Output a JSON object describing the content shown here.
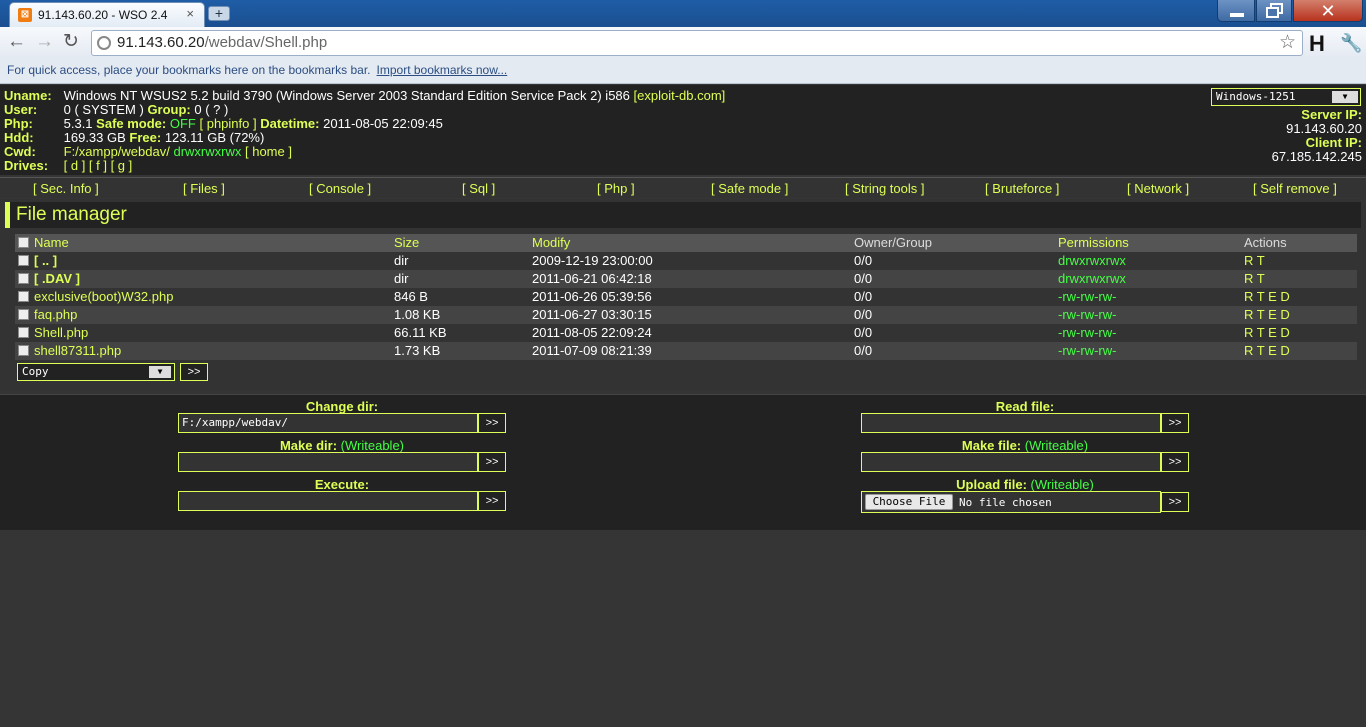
{
  "browser": {
    "tab_title": "91.143.60.20 - WSO 2.4",
    "tab_close": "×",
    "new_tab": "+",
    "url_host": "91.143.60.20",
    "url_path": "/webdav/Shell.php",
    "bookmarks_text": "For quick access, place your bookmarks here on the bookmarks bar.",
    "bookmarks_link": "Import bookmarks now...",
    "h_button": "H"
  },
  "header": {
    "uname_label": "Uname:",
    "uname_value": "Windows NT WSUS2 5.2 build 3790 (Windows Server 2003 Standard Edition Service Pack 2) i586",
    "uname_link": "[exploit-db.com]",
    "user_label": "User:",
    "user_value": "0 ( SYSTEM )",
    "group_label": "Group:",
    "group_value": "0 ( ? )",
    "php_label": "Php:",
    "php_value": "5.3.1",
    "safemode_label": "Safe mode:",
    "safemode_value": "OFF",
    "phpinfo_link": "[ phpinfo ]",
    "datetime_label": "Datetime:",
    "datetime_value": "2011-08-05 22:09:45",
    "hdd_label": "Hdd:",
    "hdd_value": "169.33 GB",
    "free_label": "Free:",
    "free_value": "123.11 GB (72%)",
    "cwd_label": "Cwd:",
    "cwd_value": "F:/xampp/webdav/",
    "cwd_perms": "drwxrwxrwx",
    "home_link": "[ home ]",
    "drives_label": "Drives:",
    "drives_value": "[ d ] [ f ] [ g ]",
    "charset": "Windows-1251",
    "server_ip_label": "Server IP:",
    "server_ip": "91.143.60.20",
    "client_ip_label": "Client IP:",
    "client_ip": "67.185.142.245"
  },
  "menu": [
    "[ Sec. Info ]",
    "[ Files ]",
    "[ Console ]",
    "[ Sql ]",
    "[ Php ]",
    "[ Safe mode ]",
    "[ String tools ]",
    "[ Bruteforce ]",
    "[ Network ]",
    "[ Self remove ]"
  ],
  "filemanager": {
    "title": "File manager",
    "columns": [
      "Name",
      "Size",
      "Modify",
      "Owner/Group",
      "Permissions",
      "Actions"
    ],
    "rows": [
      {
        "name": "[ .. ]",
        "size": "dir",
        "modify": "2009-12-19 23:00:00",
        "owner": "0/0",
        "perms": "drwxrwxrwx",
        "actions": "R T"
      },
      {
        "name": "[ .DAV ]",
        "size": "dir",
        "modify": "2011-06-21 06:42:18",
        "owner": "0/0",
        "perms": "drwxrwxrwx",
        "actions": "R T"
      },
      {
        "name": "exclusive(boot)W32.php",
        "size": "846 B",
        "modify": "2011-06-26 05:39:56",
        "owner": "0/0",
        "perms": "-rw-rw-rw-",
        "actions": "R T E D"
      },
      {
        "name": "faq.php",
        "size": "1.08 KB",
        "modify": "2011-06-27 03:30:15",
        "owner": "0/0",
        "perms": "-rw-rw-rw-",
        "actions": "R T E D"
      },
      {
        "name": "Shell.php",
        "size": "66.11 KB",
        "modify": "2011-08-05 22:09:24",
        "owner": "0/0",
        "perms": "-rw-rw-rw-",
        "actions": "R T E D"
      },
      {
        "name": "shell87311.php",
        "size": "1.73 KB",
        "modify": "2011-07-09 08:21:39",
        "owner": "0/0",
        "perms": "-rw-rw-rw-",
        "actions": "R T E D"
      }
    ],
    "action_select": "Copy",
    "go": ">>"
  },
  "forms": {
    "change_dir_label": "Change dir:",
    "change_dir_value": "F:/xampp/webdav/",
    "make_dir_label": "Make dir:",
    "writeable": "(Writeable)",
    "execute_label": "Execute:",
    "read_file_label": "Read file:",
    "make_file_label": "Make file:",
    "upload_file_label": "Upload file:",
    "choose_file": "Choose File",
    "no_file": "No file chosen",
    "go": ">>"
  }
}
